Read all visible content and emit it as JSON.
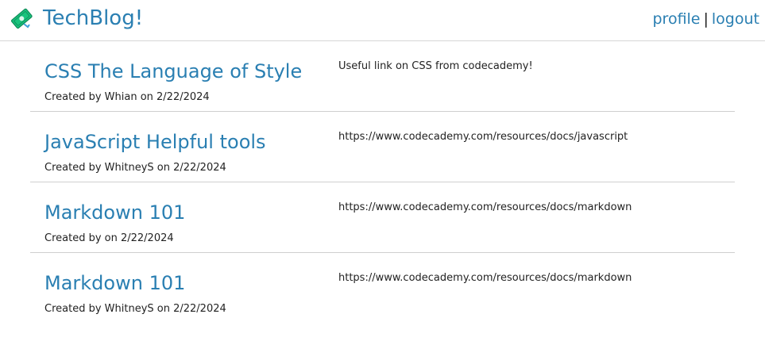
{
  "header": {
    "title": "TechBlog!",
    "logo_icon": "money-bill-icon",
    "brand_color": "#2a7fb2",
    "nav": {
      "profile_label": "profile",
      "separator": "|",
      "logout_label": "logout"
    }
  },
  "posts": [
    {
      "title": "CSS The Language of Style",
      "meta": "Created by Whian on 2/22/2024",
      "content": "Useful link on CSS from codecademy!"
    },
    {
      "title": "JavaScript Helpful tools",
      "meta": "Created by WhitneyS on 2/22/2024",
      "content": "https://www.codecademy.com/resources/docs/javascript"
    },
    {
      "title": "Markdown 101",
      "meta": "Created by on 2/22/2024",
      "content": "https://www.codecademy.com/resources/docs/markdown"
    },
    {
      "title": "Markdown 101",
      "meta": "Created by WhitneyS on 2/22/2024",
      "content": "https://www.codecademy.com/resources/docs/markdown"
    }
  ]
}
